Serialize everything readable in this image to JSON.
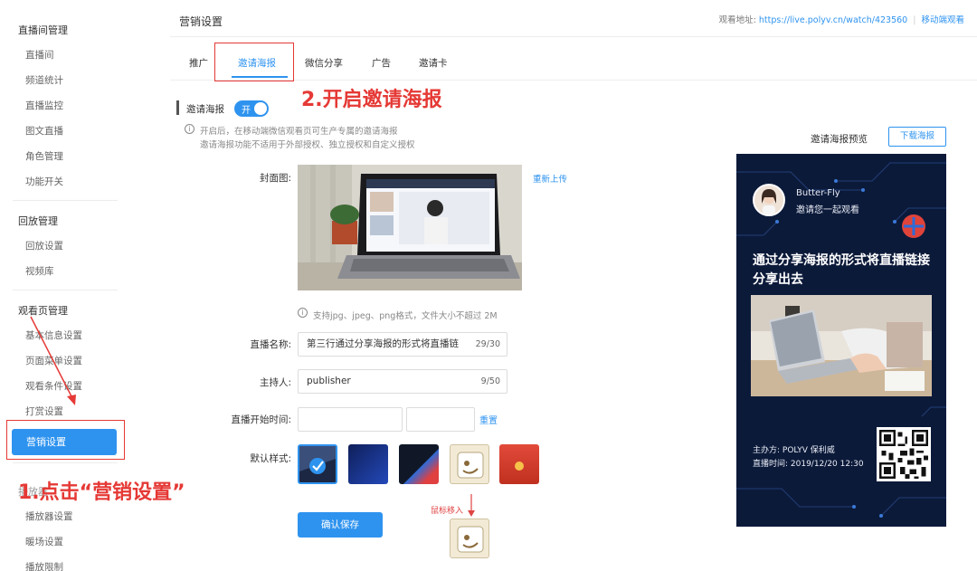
{
  "sidebar": {
    "groups": [
      {
        "title": "直播间管理",
        "items": [
          "直播间",
          "频道统计",
          "直播监控",
          "图文直播",
          "角色管理",
          "功能开关"
        ]
      },
      {
        "title": "回放管理",
        "items": [
          "回放设置",
          "视频库"
        ]
      },
      {
        "title": "观看页管理",
        "items": [
          "基本信息设置",
          "页面菜单设置",
          "观看条件设置",
          "打赏设置"
        ]
      },
      {
        "title": "播放器",
        "items": [
          "播放器设置",
          "暖场设置",
          "播放限制"
        ]
      }
    ],
    "active_item": "营销设置"
  },
  "header": {
    "title": "营销设置",
    "watch_label": "观看地址:",
    "watch_url": "https://live.polyv.cn/watch/423560",
    "mobile_link": "移动端观看"
  },
  "tabs": [
    "推广",
    "邀请海报",
    "微信分享",
    "广告",
    "邀请卡"
  ],
  "active_tab": "邀请海报",
  "section": {
    "title": "邀请海报",
    "toggle_label": "开",
    "toggle_on": true,
    "note_line1": "开启后，在移动端微信观看页可生产专属的邀请海报",
    "note_line2": "邀请海报功能不适用于外部授权、独立授权和自定义授权"
  },
  "form": {
    "cover_label": "封面图:",
    "reupload": "重新上传",
    "format_note": "支持jpg、jpeg、png格式，文件大小不超过 2M",
    "name_label": "直播名称:",
    "name_value": "第三行通过分享海报的形式将直播链",
    "name_count": "29/30",
    "host_label": "主持人:",
    "host_value": "publisher",
    "host_count": "9/50",
    "start_label": "直播开始时间:",
    "start_date": "",
    "start_time": "",
    "reset": "重置",
    "style_label": "默认样式:",
    "save": "确认保存",
    "hover_label": "鼠标移入"
  },
  "preview": {
    "title": "邀请海报预览",
    "download": "下载海报",
    "user_name": "Butter-Fly",
    "invite_text": "邀请您一起观看",
    "headline": "通过分享海报的形式将直播链接分享出去",
    "organizer": "主办方: POLYV 保利威",
    "live_time": "直播时间: 2019/12/20 12:30"
  },
  "annotations": {
    "step1": "1.点击“营销设置”",
    "step2": "2.开启邀请海报"
  },
  "colors": {
    "accent": "#2e93ef",
    "annotation": "#e53935",
    "poster_bg": "#0c1a3a"
  }
}
